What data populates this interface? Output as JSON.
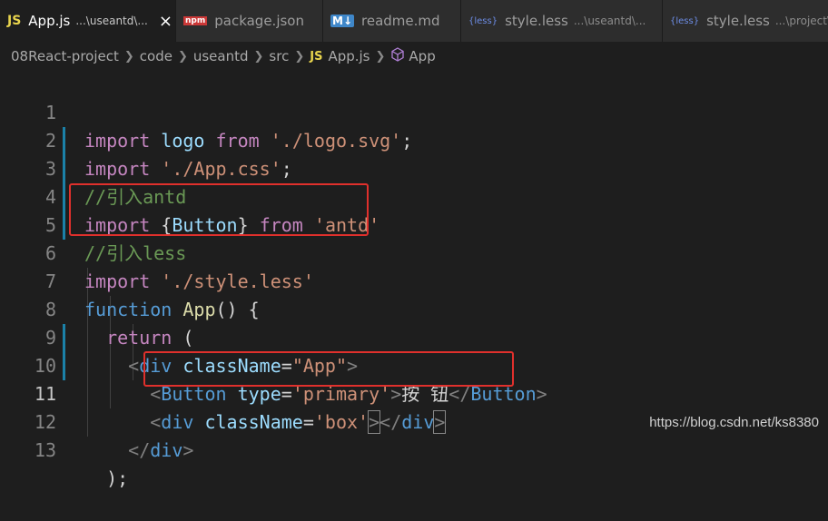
{
  "tabs": [
    {
      "icon": "JS",
      "label": "App.js",
      "desc": "...\\useantd\\...",
      "close": "×"
    },
    {
      "icon": "npm",
      "label": "package.json",
      "desc": ""
    },
    {
      "icon": "M↓",
      "label": "readme.md",
      "desc": ""
    },
    {
      "icon": "{less}",
      "label": "style.less",
      "desc": "...\\useantd\\..."
    },
    {
      "icon": "{less}",
      "label": "style.less",
      "desc": "...\\project\\src"
    }
  ],
  "breadcrumb": {
    "items": [
      "08React-project",
      "code",
      "useantd",
      "src"
    ],
    "file_icon": "JS",
    "file": "App.js",
    "symbol": "App"
  },
  "line_numbers": [
    "1",
    "2",
    "3",
    "4",
    "5",
    "6",
    "7",
    "8",
    "9",
    "10",
    "11",
    "12",
    "13"
  ],
  "code": {
    "l1": {
      "kw": "import",
      "id": "logo",
      "kw2": "from",
      "str": "'./logo.svg'",
      "p": ";"
    },
    "l2": {
      "kw": "import",
      "str": "'./App.css'",
      "p": ";"
    },
    "l3": {
      "cm": "//引入antd"
    },
    "l4": {
      "kw": "import",
      "p1": "{",
      "id": "Button",
      "p2": "}",
      "kw2": "from",
      "str": "'antd'"
    },
    "l5": {
      "cm": "//引入less"
    },
    "l6": {
      "kw": "import",
      "str": "'./style.less'"
    },
    "l7": {
      "kw": "function",
      "fn": "App",
      "p": "() {"
    },
    "l8": {
      "kw": "return",
      "p": "("
    },
    "l9": {
      "lt": "<",
      "tag": "div",
      "attr": "className",
      "eq": "=",
      "str": "\"App\"",
      "gt": ">"
    },
    "l10": {
      "lt": "<",
      "tag": "Button",
      "attr": "type",
      "eq": "=",
      "str": "'primary'",
      "gt": ">",
      "text": "按 钮",
      "lt2": "</",
      "tag2": "Button",
      "gt2": ">"
    },
    "l11": {
      "lt": "<",
      "tag": "div",
      "attr": "className",
      "eq": "=",
      "str": "'box'",
      "gt": ">",
      "lt2": "</",
      "tag2": "div",
      "gt2": ">"
    },
    "l12": {
      "lt": "</",
      "tag": "div",
      "gt": ">"
    },
    "l13": {
      "p": ");"
    }
  },
  "watermark": "https://blog.csdn.net/ks8380",
  "colors": {
    "keyword": "#c586c0",
    "string": "#ce9178",
    "comment": "#6a9955",
    "tag": "#569cd6",
    "highlight_box": "#e0302c"
  }
}
